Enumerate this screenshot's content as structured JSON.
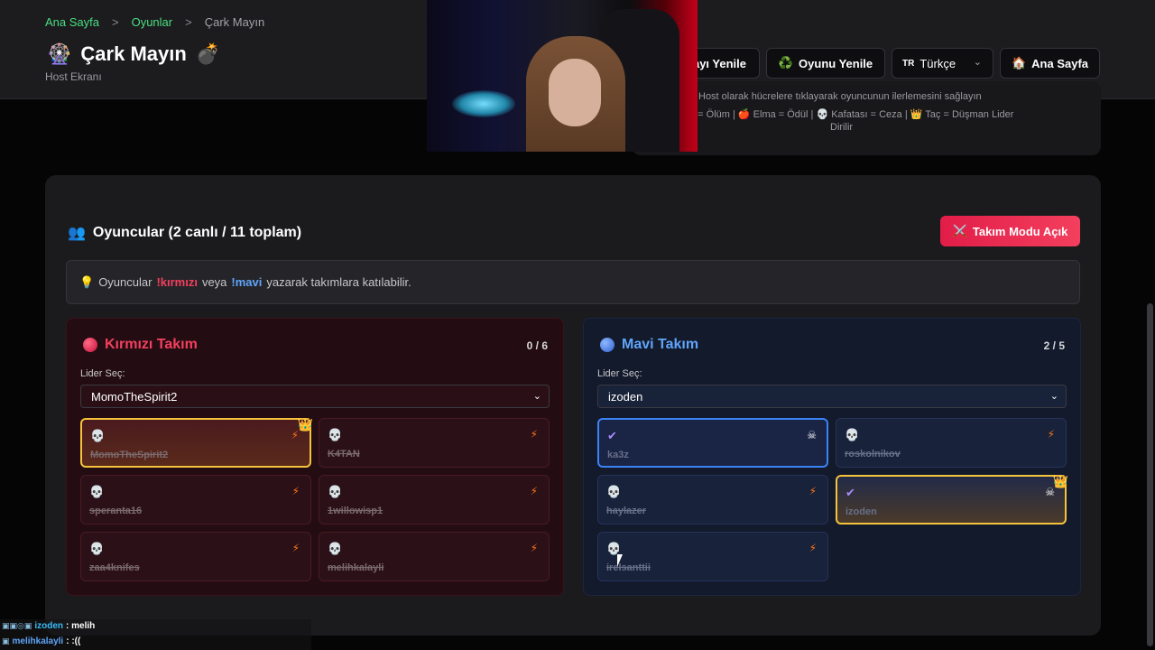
{
  "breadcrumb": {
    "home": "Ana Sayfa",
    "games": "Oyunlar",
    "current": "Çark Mayın",
    "sep": ">"
  },
  "header": {
    "title": "Çark Mayın",
    "title_icon_left": "🎡",
    "title_icon_right": "💣",
    "subtitle": "Host Ekranı",
    "btn_refresh_partial": "ayı Yenile",
    "btn_restart": "Oyunu Yenile",
    "btn_restart_icon": "♻️",
    "lang_code": "TR",
    "lang_label": "Türkçe",
    "btn_home": "Ana Sayfa",
    "btn_home_icon": "🏠"
  },
  "info": {
    "line1": "Host olarak hücrelere tıklayarak oyuncunun ilerlemesini sağlayın",
    "line2": "n = Ölüm | 🍎 Elma = Ödül | 💀 Kafatası = Ceza | 👑 Taç = Düşman Lider",
    "line3": "Dirilir"
  },
  "players": {
    "icon": "👥",
    "heading": "Oyuncular (2 canlı / 11 toplam)",
    "team_mode_icon": "⚔️",
    "team_mode_btn": "Takım Modu Açık",
    "hint_icon": "💡",
    "hint_pre": "Oyuncular",
    "hint_red": "!kırmızı",
    "hint_mid": "veya",
    "hint_blue": "!mavi",
    "hint_post": "yazarak takımlara katılabilir."
  },
  "red_team": {
    "title": "Kırmızı Takım",
    "count": "0 / 6",
    "leader_label": "Lider Seç:",
    "leader_selected": "MomoTheSpirit2",
    "color": "#f43f5e",
    "players": [
      "MomoTheSpirit2",
      "K4TAN",
      "speranta16",
      "1willowisp1",
      "zaa4knifes",
      "melihkalayli"
    ]
  },
  "blue_team": {
    "title": "Mavi Takım",
    "count": "2 / 5",
    "leader_label": "Lider Seç:",
    "leader_selected": "izoden",
    "color": "#60a5fa",
    "players": [
      "ka3z",
      "roskolnikov",
      "haylazer",
      "izoden",
      "irelsanttii"
    ]
  },
  "chat": {
    "user1": "izoden",
    "msg1": ": melih",
    "user2": "melihkalayli",
    "msg2": ": :(("
  }
}
